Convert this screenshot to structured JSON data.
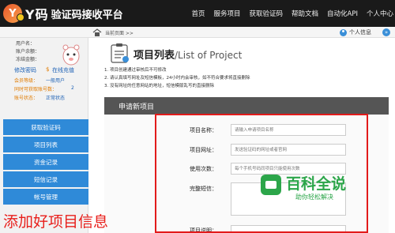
{
  "brand": {
    "logo_mark": "Y",
    "name": "Y码",
    "subtitle": "验证码接收平台"
  },
  "top_nav": [
    "首页",
    "服务项目",
    "获取验证码",
    "帮助文档",
    "自动化API",
    "个人中心"
  ],
  "subbar": {
    "breadcrumb": "当前页面 >>",
    "personal_info": "个人信息",
    "toggle_symbol": "»"
  },
  "sidebar": {
    "profile": {
      "username_label": "用户名：",
      "balance_label": "账户余额：",
      "frozen_label": "冻结金额：",
      "change_password": "修改密码",
      "online_recharge": "在线充值",
      "member_level_label": "会员等级：",
      "member_level_value": "一般用户",
      "concurrent_label": "同时可获取账号数：",
      "concurrent_value": "2",
      "account_status_label": "账号状态：",
      "account_status_value": "正常状态"
    },
    "menu": [
      "获取验证码",
      "项目列表",
      "资金记录",
      "短信记录",
      "帐号管理"
    ]
  },
  "main": {
    "title": "项目列表",
    "title_en": "/List of Project",
    "notes": [
      "1. 项目创建通过审核后不可修改",
      "2. 请认真填写网址及短信模板，24小时内会审核，如不符合要求将直接删除",
      "3. 没有网址的任意网站的地址，短信模版乱写的直接删除"
    ],
    "section_title": "申请新项目",
    "form": {
      "fields": [
        {
          "label": "项目名称：",
          "placeholder": "请输入申请项目名称"
        },
        {
          "label": "项目网址：",
          "placeholder": "发送验证码的网址或者官网"
        },
        {
          "label": "使用次数：",
          "placeholder": "每个手机号码同项目只能使用次数"
        }
      ],
      "template_label": "完整短信：",
      "description_label": "项目说明："
    }
  },
  "annotation": "添加好项目信息",
  "watermark": {
    "title": "百科全说",
    "subtitle": "助你轻松解决"
  },
  "colors": {
    "topbar": "#1a1a1a",
    "sidebar_button": "#2f8ad8",
    "section_bar": "#555555",
    "highlight_red": "#e21b1b",
    "watermark_green": "#2ca64a",
    "link_blue": "#1a5fb4",
    "link_orange": "#e07b00"
  }
}
